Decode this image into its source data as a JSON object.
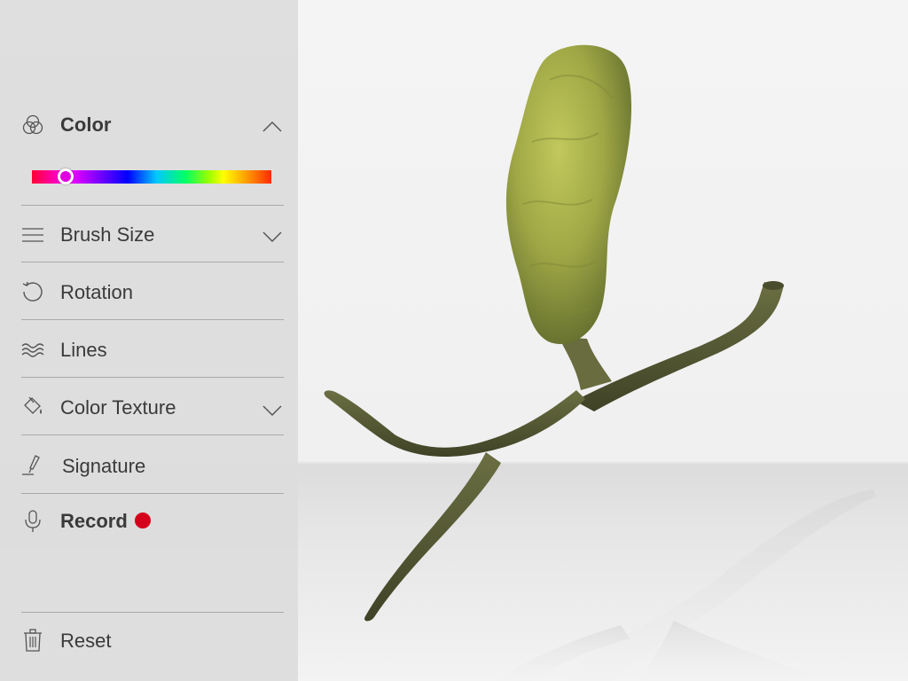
{
  "menu": {
    "color": {
      "label": "Color",
      "icon": "color-circles-icon",
      "expanded": true,
      "hue_position": 0.14,
      "thumb_color": "#e000e0"
    },
    "brush_size": {
      "label": "Brush Size",
      "icon": "lines-icon"
    },
    "rotation": {
      "label": "Rotation",
      "icon": "rotate-icon"
    },
    "lines": {
      "label": "Lines",
      "icon": "waves-icon"
    },
    "color_texture": {
      "label": "Color Texture",
      "icon": "paint-bucket-icon"
    },
    "signature": {
      "label": "Signature",
      "icon": "pen-icon"
    },
    "record": {
      "label": "Record",
      "icon": "microphone-icon",
      "indicator_color": "#d4001c"
    },
    "reset": {
      "label": "Reset",
      "icon": "trash-icon"
    }
  },
  "colors": {
    "panel_bg": "#dcdcdc",
    "text": "#3a3a3a",
    "model": "#5b6036",
    "model_highlight": "#b3bd52"
  }
}
